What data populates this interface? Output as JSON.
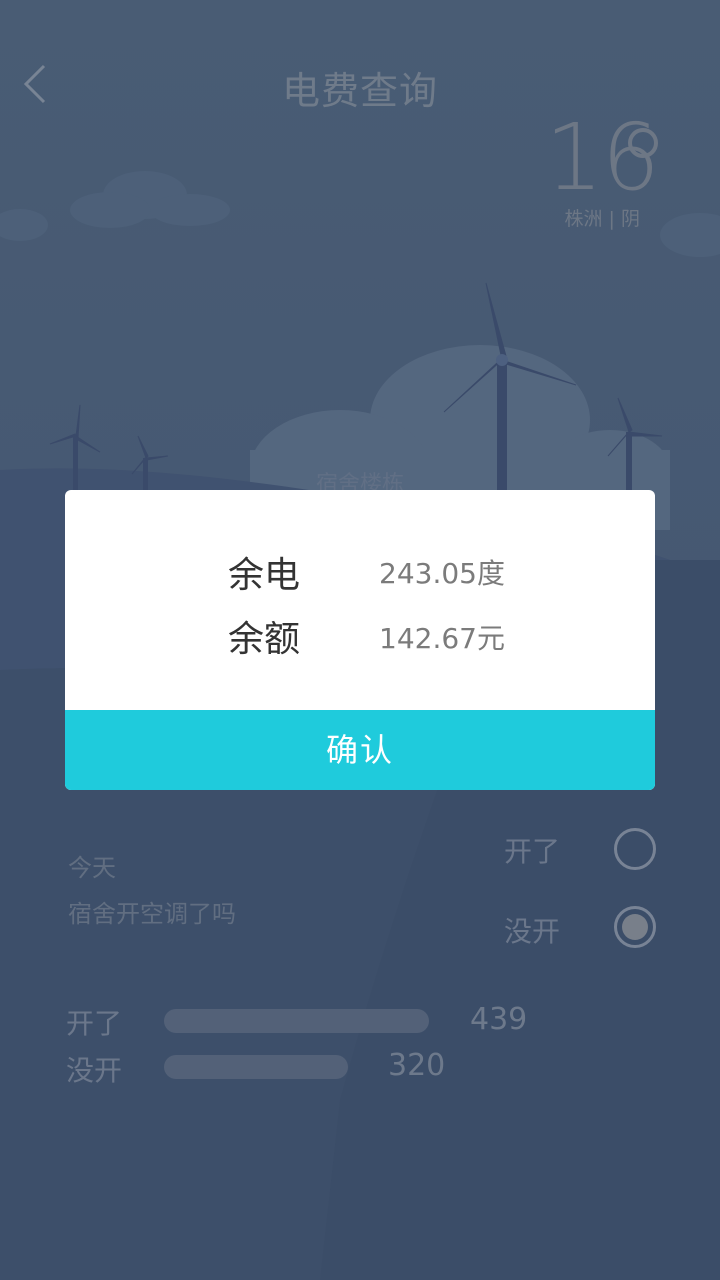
{
  "header": {
    "title": "电费查询"
  },
  "weather": {
    "temperature": "16",
    "location_condition": "株洲 | 阴"
  },
  "form": {
    "dorm_label": "宿舍楼栋"
  },
  "poll": {
    "question_line1": "今天",
    "question_line2": "宿舍开空调了吗",
    "option_on": "开了",
    "option_off": "没开",
    "selected": "没开"
  },
  "stats": [
    {
      "label": "开了",
      "count": "439"
    },
    {
      "label": "没开",
      "count": "320"
    }
  ],
  "dialog": {
    "electricity_label": "余电",
    "electricity_value": "243.05度",
    "balance_label": "余额",
    "balance_value": "142.67元",
    "confirm_label": "确认"
  },
  "colors": {
    "accent": "#1fcbdc",
    "background": "#4e6079"
  }
}
